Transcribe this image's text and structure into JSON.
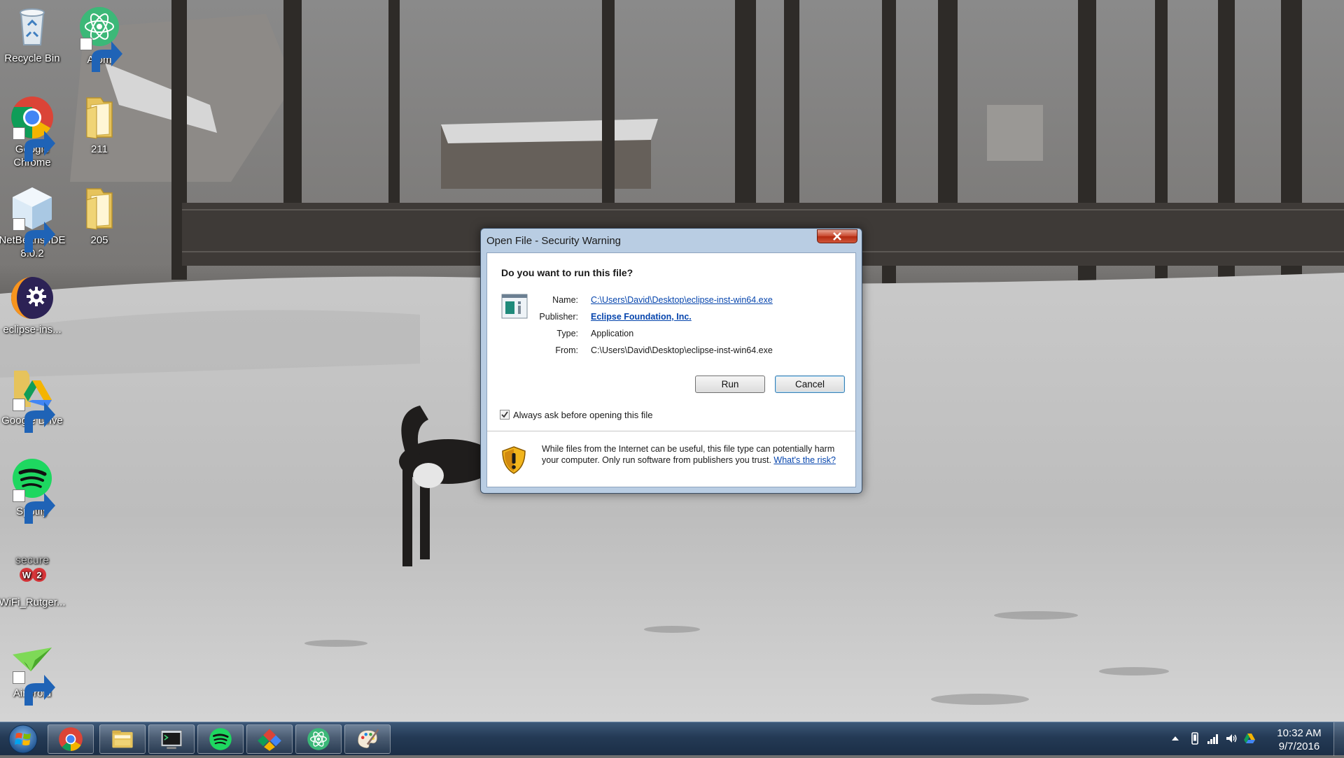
{
  "desktop": {
    "icons": [
      {
        "label": "Recycle Bin",
        "icon": "recycle-bin-icon"
      },
      {
        "label": "Atom",
        "icon": "atom-icon"
      },
      {
        "label": "Google Chrome",
        "icon": "chrome-icon"
      },
      {
        "label": "211",
        "icon": "folder-icon"
      },
      {
        "label": "NetBeans IDE 8.0.2",
        "icon": "netbeans-icon"
      },
      {
        "label": "205",
        "icon": "folder-icon"
      },
      {
        "label": "eclipse-ins...",
        "icon": "eclipse-installer-icon"
      },
      {
        "label": "Google Drive",
        "icon": "google-drive-icon"
      },
      {
        "label": "Spotify",
        "icon": "spotify-icon"
      },
      {
        "label": "WiFi_Rutger...",
        "icon": "securew2-icon",
        "logo_text": "secure W2"
      },
      {
        "label": "AirDroid",
        "icon": "airdroid-icon"
      }
    ]
  },
  "dialog": {
    "title": "Open File - Security Warning",
    "question": "Do you want to run this file?",
    "name_label": "Name:",
    "name_value": "C:\\Users\\David\\Desktop\\eclipse-inst-win64.exe",
    "publisher_label": "Publisher:",
    "publisher_value": "Eclipse Foundation, Inc.",
    "type_label": "Type:",
    "type_value": "Application",
    "from_label": "From:",
    "from_value": "C:\\Users\\David\\Desktop\\eclipse-inst-win64.exe",
    "run_label": "Run",
    "cancel_label": "Cancel",
    "checkbox_label": "Always ask before opening this file",
    "checkbox_checked": true,
    "warning_text": "While files from the Internet can be useful, this file type can potentially harm your computer. Only run software from publishers you trust.",
    "warning_link": "What's the risk?"
  },
  "taskbar": {
    "pinned": [
      "chrome-icon",
      "file-explorer-icon",
      "command-prompt-icon",
      "spotify-icon",
      "google-apps-icon",
      "atom-icon",
      "paint-icon"
    ],
    "tray": [
      "show-hidden-icons-icon",
      "phone-icon",
      "network-icon",
      "volume-icon",
      "google-drive-icon"
    ],
    "time": "10:32 AM",
    "date": "9/7/2016"
  },
  "colors": {
    "link": "#0645ad",
    "taskbar": "#243a55",
    "dialog_frame": "#b9cde3"
  }
}
